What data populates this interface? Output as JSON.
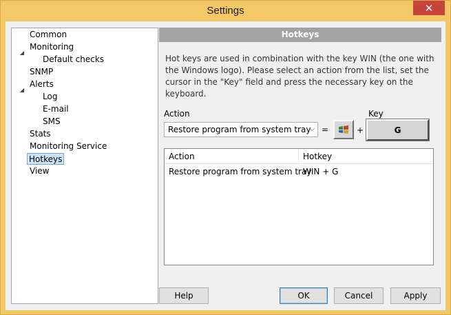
{
  "window": {
    "title": "Settings",
    "close_label": "✕"
  },
  "tree": {
    "items": [
      {
        "label": "Common",
        "level": 0,
        "expander": ""
      },
      {
        "label": "Monitoring",
        "level": 0,
        "expander": "◢"
      },
      {
        "label": "Default checks",
        "level": 1,
        "expander": ""
      },
      {
        "label": "SNMP",
        "level": 0,
        "expander": ""
      },
      {
        "label": "Alerts",
        "level": 0,
        "expander": "◢"
      },
      {
        "label": "Log",
        "level": 1,
        "expander": ""
      },
      {
        "label": "E-mail",
        "level": 1,
        "expander": ""
      },
      {
        "label": "SMS",
        "level": 1,
        "expander": ""
      },
      {
        "label": "Stats",
        "level": 0,
        "expander": ""
      },
      {
        "label": "Monitoring Service",
        "level": 0,
        "expander": ""
      },
      {
        "label": "Hotkeys",
        "level": 0,
        "expander": "",
        "selected": true
      },
      {
        "label": "View",
        "level": 0,
        "expander": ""
      }
    ]
  },
  "panel": {
    "header": "Hotkeys",
    "description": "Hot keys are used in combination with the key WIN (the one with the Windows logo). Please select an action from the list, set the cursor in the \"Key\" field and press the necessary key on the keyboard."
  },
  "action": {
    "label": "Action",
    "selected_value": "Restore program from system tray",
    "equals": "=",
    "plus": "+"
  },
  "key": {
    "label": "Key",
    "value": "G"
  },
  "list": {
    "columns": [
      "Action",
      "Hotkey"
    ],
    "rows": [
      {
        "action": "Restore program from system tray",
        "hotkey": "WIN + G"
      }
    ]
  },
  "buttons": {
    "help": "Help",
    "ok": "OK",
    "cancel": "Cancel",
    "apply": "Apply"
  },
  "colors": {
    "titlebar": "#f4c867",
    "close": "#c7443a",
    "header_band": "#a3a3a3",
    "selection": "#cce4f7"
  }
}
